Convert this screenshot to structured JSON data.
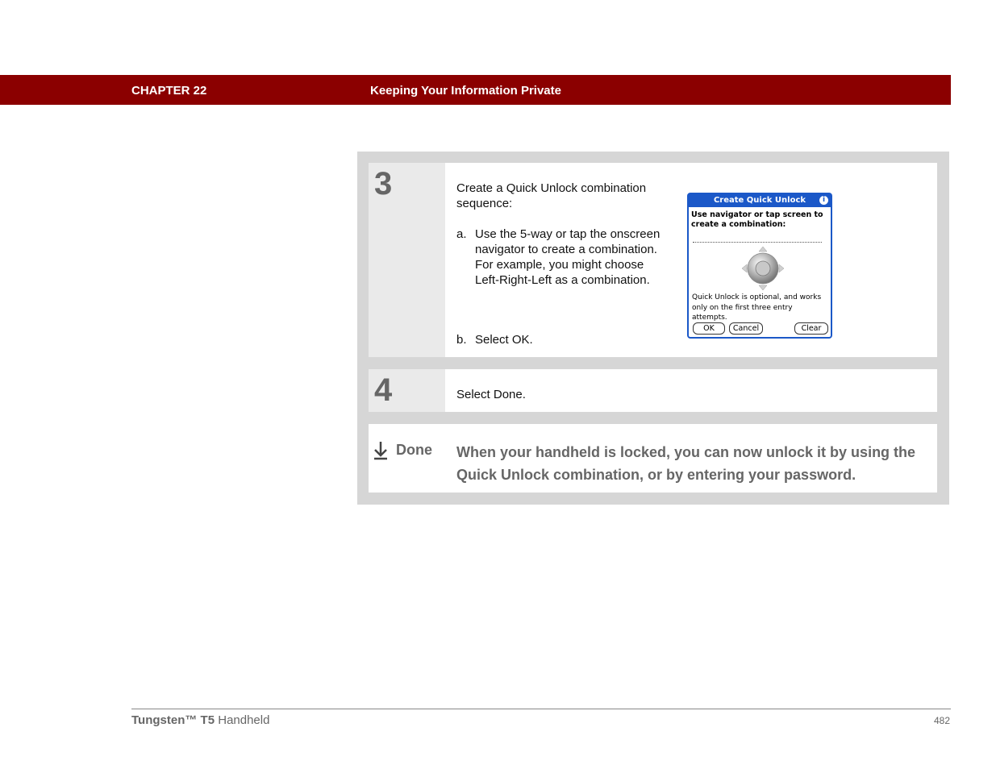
{
  "header": {
    "chapter": "CHAPTER 22",
    "title": "Keeping Your Information Private"
  },
  "steps": [
    {
      "number": "3",
      "intro": "Create a Quick Unlock combination sequence:",
      "items": [
        {
          "marker": "a.",
          "text": "Use the 5-way or tap the onscreen navigator to create a combination.",
          "extra": "For example, you might choose Left-Right-Left as a combination."
        },
        {
          "marker": "b.",
          "text": "Select OK."
        }
      ]
    },
    {
      "number": "4",
      "text": "Select Done."
    }
  ],
  "done": {
    "label": "Done",
    "text": "When your handheld is locked, you can now unlock it by using the Quick Unlock combination, or by entering your password."
  },
  "dialog": {
    "title": "Create Quick Unlock",
    "info_icon": "i",
    "instruction": "Use navigator or tap screen to create a combination:",
    "note": "Quick Unlock is optional, and works only on the first three entry attempts.",
    "buttons": {
      "ok": "OK",
      "cancel": "Cancel",
      "clear": "Clear"
    },
    "colors": {
      "title_bar": "#1b58c8"
    }
  },
  "footer": {
    "product_brand": "Tungsten™ T5",
    "product_suffix": "Handheld",
    "page": "482"
  },
  "colors": {
    "header_bar": "#8b0000",
    "panel": "#d6d6d6",
    "muted_text": "#666666"
  }
}
